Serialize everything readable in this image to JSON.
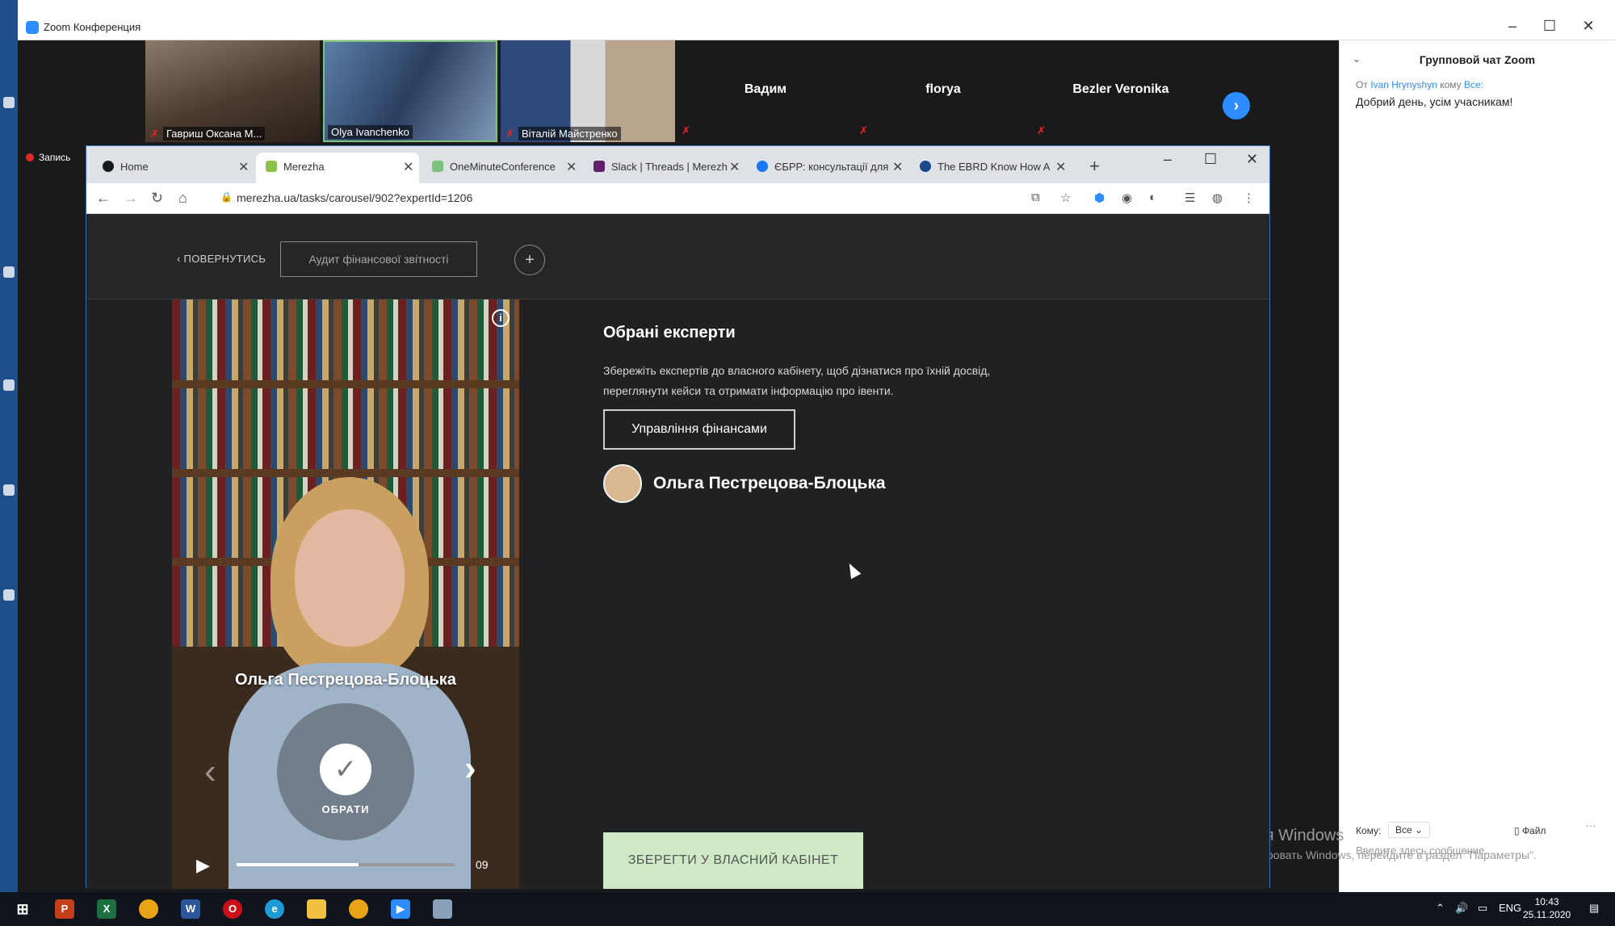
{
  "zoom": {
    "title": "Zoom Конференция",
    "recording_label": "Запись",
    "participants": [
      {
        "name": "Гавриш Оксана М..."
      },
      {
        "name": "Olya Ivanchenko"
      },
      {
        "name": "Віталій Майстренко"
      },
      {
        "name": "Вадим"
      },
      {
        "name": "florya"
      },
      {
        "name": "Bezler Veronika"
      }
    ],
    "chat": {
      "title": "Групповой чат Zoom",
      "from_prefix": "От",
      "from_user": "Ivan Hrynyshyn",
      "to_prefix": "кому",
      "to_user": "Все:",
      "message": "Добрий день, усім учасникам!",
      "to_label": "Кому:",
      "to_value": "Все",
      "file_label": "Файл",
      "more_label": "···",
      "input_placeholder": "Введите здесь сообщение..."
    }
  },
  "windows_activation": {
    "line1": "Активация Windows",
    "line2": "Чтобы активировать Windows, перейдите в раздел \"Параметры\"."
  },
  "browser": {
    "tabs": [
      {
        "label": "Home",
        "icon_color": "#1a1a1a"
      },
      {
        "label": "Merezha",
        "icon_color": "#8bc34a"
      },
      {
        "label": "OneMinuteConference",
        "icon_color": "#7cc47c"
      },
      {
        "label": "Slack | Threads | Merezh",
        "icon_color": "#611f69"
      },
      {
        "label": "ЄБРР: консультації для",
        "icon_color": "#1877f2"
      },
      {
        "label": "The EBRD Know How A",
        "icon_color": "#1a4a8a"
      }
    ],
    "url": "merezha.ua/tasks/carousel/902?expertId=1206"
  },
  "page": {
    "back_label": "ПОВЕРНУТИСЬ",
    "category_button": "Аудит фінансової звітності",
    "expert_card": {
      "name": "Ольга Пестрецова-Блоцька",
      "choose_label": "ОБРАТИ",
      "video_time": "09",
      "progress": 0.56
    },
    "selected_title": "Обрані експерти",
    "selected_description": "Збережіть експертів до власного кабінету, щоб дізнатися про їхній досвід, переглянути кейси та отримати інформацію про івенти.",
    "topic_button": "Управління фінансами",
    "selected_expert_name": "Ольга Пестрецова-Блоцька",
    "save_button": "ЗБЕРЕГТИ У ВЛАСНИЙ КАБІНЕТ"
  },
  "taskbar": {
    "language": "ENG",
    "time": "10:43",
    "date": "25.11.2020"
  }
}
